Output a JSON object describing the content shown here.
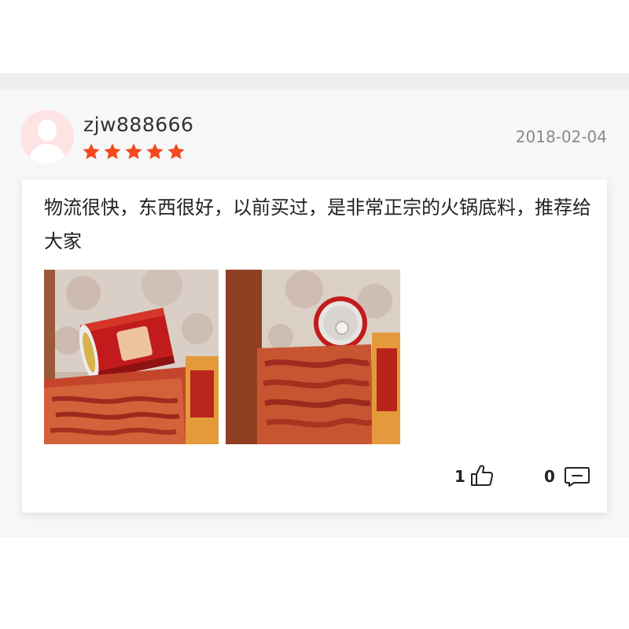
{
  "review": {
    "username": "zjw888666",
    "date": "2018-02-04",
    "rating": 5,
    "star_color": "#f24a1d",
    "text": "物流很快，东西很好，以前买过，是非常正宗的火锅底料，推荐给大家",
    "photos": [
      {
        "description": "product-photo-1"
      },
      {
        "description": "product-photo-2"
      }
    ],
    "likes": "1",
    "replies": "0"
  }
}
